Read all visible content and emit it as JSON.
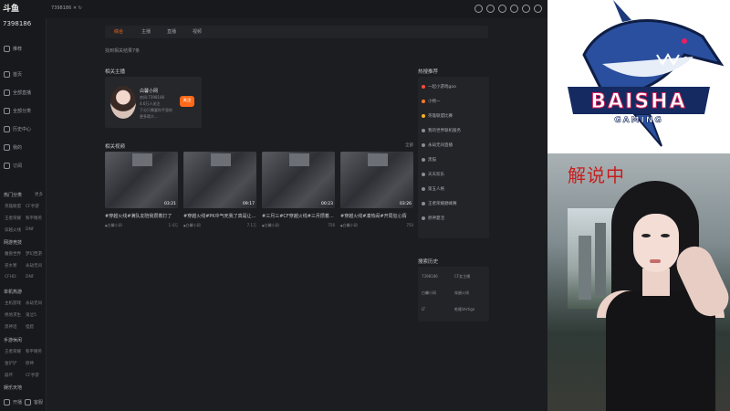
{
  "app": {
    "logo_text": "斗鱼",
    "user_id": "7398186",
    "topbar_id": "7398186",
    "sidebar": {
      "items": [
        "推荐",
        "首页",
        "全部直播",
        "全部分类",
        "历史中心",
        "我的",
        "订阅"
      ],
      "groups": [
        {
          "label": "热门分类",
          "more": "更多",
          "subs": [
            "英雄联盟",
            "CF手游",
            "王者荣耀",
            "和平精英",
            "穿越火线",
            "DNF"
          ]
        },
        {
          "label": "网游竞技",
          "subs": [
            "魔兽世界",
            "梦幻西游",
            "逆水寒",
            "永劫无间",
            "CFHD",
            "DNF"
          ]
        },
        {
          "label": "单机热游",
          "subs": [
            "主机游戏",
            "永劫无间",
            "绝地求生",
            "鬼泣5",
            "黑神话",
            "怪猎"
          ]
        },
        {
          "label": "手游休闲",
          "subs": [
            "王者荣耀",
            "和平精英",
            "金铲铲",
            "原神",
            "崩坏",
            "CF手游"
          ]
        },
        {
          "label": "娱乐天地"
        }
      ],
      "bottom": [
        "开播",
        "客服"
      ]
    },
    "tabs": [
      "综合",
      "主播",
      "直播",
      "视频"
    ],
    "active_tab_index": 0,
    "breadcrumb": "找到相关结果7条",
    "related_streamer_title": "相关主播",
    "streamer": {
      "name": "白馨小网",
      "room": "房间:7398186",
      "followers": "4.6万人关注",
      "desc": "下分只需要你手里的",
      "extra": "更多简介...",
      "follow_label": "关注"
    },
    "related_videos_title": "相关视频",
    "videos_more": "全部",
    "videos": [
      {
        "title": "#穿越火线#满队友陪我攒着打了",
        "user": "白馨小网",
        "views": "1.4万",
        "duration": "03:21"
      },
      {
        "title": "#穿越火线#PK中气死我了真是让...",
        "user": "白馨小网",
        "views": "7.1万",
        "duration": "09:17"
      },
      {
        "title": "#三月三#CF穿越火线#三月攒着...",
        "user": "白馨小网",
        "views": "756",
        "duration": "00:23"
      },
      {
        "title": "#穿越火线#凑热闹#开局狂心情",
        "user": "白馨小网",
        "views": "750",
        "duration": "03:26"
      }
    ],
    "hot_search_title": "热搜推荐",
    "hot_search": [
      {
        "label": "一起小游戏goo",
        "color": "#ff4a3d"
      },
      {
        "label": "小熙一",
        "color": "#ff7a2a"
      },
      {
        "label": "英雄联盟比赛",
        "color": "#ffb21a"
      },
      {
        "label": "我的世界联机服务",
        "color": "#8a8c92"
      },
      {
        "label": "永劫无间直播",
        "color": "#8a8c92"
      },
      {
        "label": "黑猫",
        "color": "#8a8c92"
      },
      {
        "label": "天天欢乐",
        "color": "#8a8c92"
      },
      {
        "label": "第五人格",
        "color": "#8a8c92"
      },
      {
        "label": "王者荣耀巅峰赛",
        "color": "#8a8c92"
      },
      {
        "label": "原神夏活",
        "color": "#8a8c92"
      }
    ],
    "history_title": "搜索历史",
    "history": [
      "7398186",
      "CF女主播",
      "白馨小网",
      "穿越火线",
      "LT",
      "乾隆Vertigo"
    ]
  },
  "brand": {
    "logo_main": "BAISHA",
    "logo_sub": "GAMING"
  },
  "camera": {
    "overlay_text": "解说中"
  }
}
